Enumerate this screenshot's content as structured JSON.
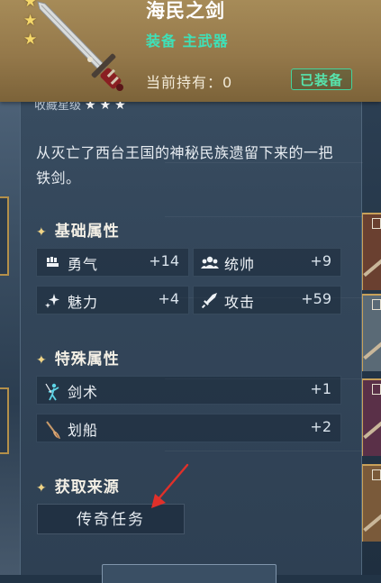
{
  "item": {
    "name": "海民之剑",
    "type_line": "装备 主武器",
    "owned_text": "当前持有：0",
    "equipped_label": "已装备",
    "stars": 3,
    "sub_label_partial": "收藏星级"
  },
  "description": "从灭亡了西台王国的神秘民族遗留下来的一把铁剑。",
  "basic_attributes": {
    "title": "基础属性",
    "stats": [
      {
        "name": "勇气",
        "value": "+14",
        "icon": "fist-icon"
      },
      {
        "name": "统帅",
        "value": "+9",
        "icon": "group-icon"
      },
      {
        "name": "魅力",
        "value": "+4",
        "icon": "sparkle-icon"
      },
      {
        "name": "攻击",
        "value": "+59",
        "icon": "sword-icon"
      }
    ]
  },
  "special_attributes": {
    "title": "特殊属性",
    "stats": [
      {
        "name": "剑术",
        "value": "+1",
        "icon": "swordsman-icon"
      },
      {
        "name": "划船",
        "value": "+2",
        "icon": "oar-icon"
      }
    ]
  },
  "source": {
    "title": "获取来源",
    "button_label": "传奇任务"
  },
  "colors": {
    "header_gold": "#a68b58",
    "accent_green": "#3fe0b8",
    "badge_green": "#43d49c",
    "panel_blue": "#34475b",
    "arrow_red": "#e0302a"
  }
}
